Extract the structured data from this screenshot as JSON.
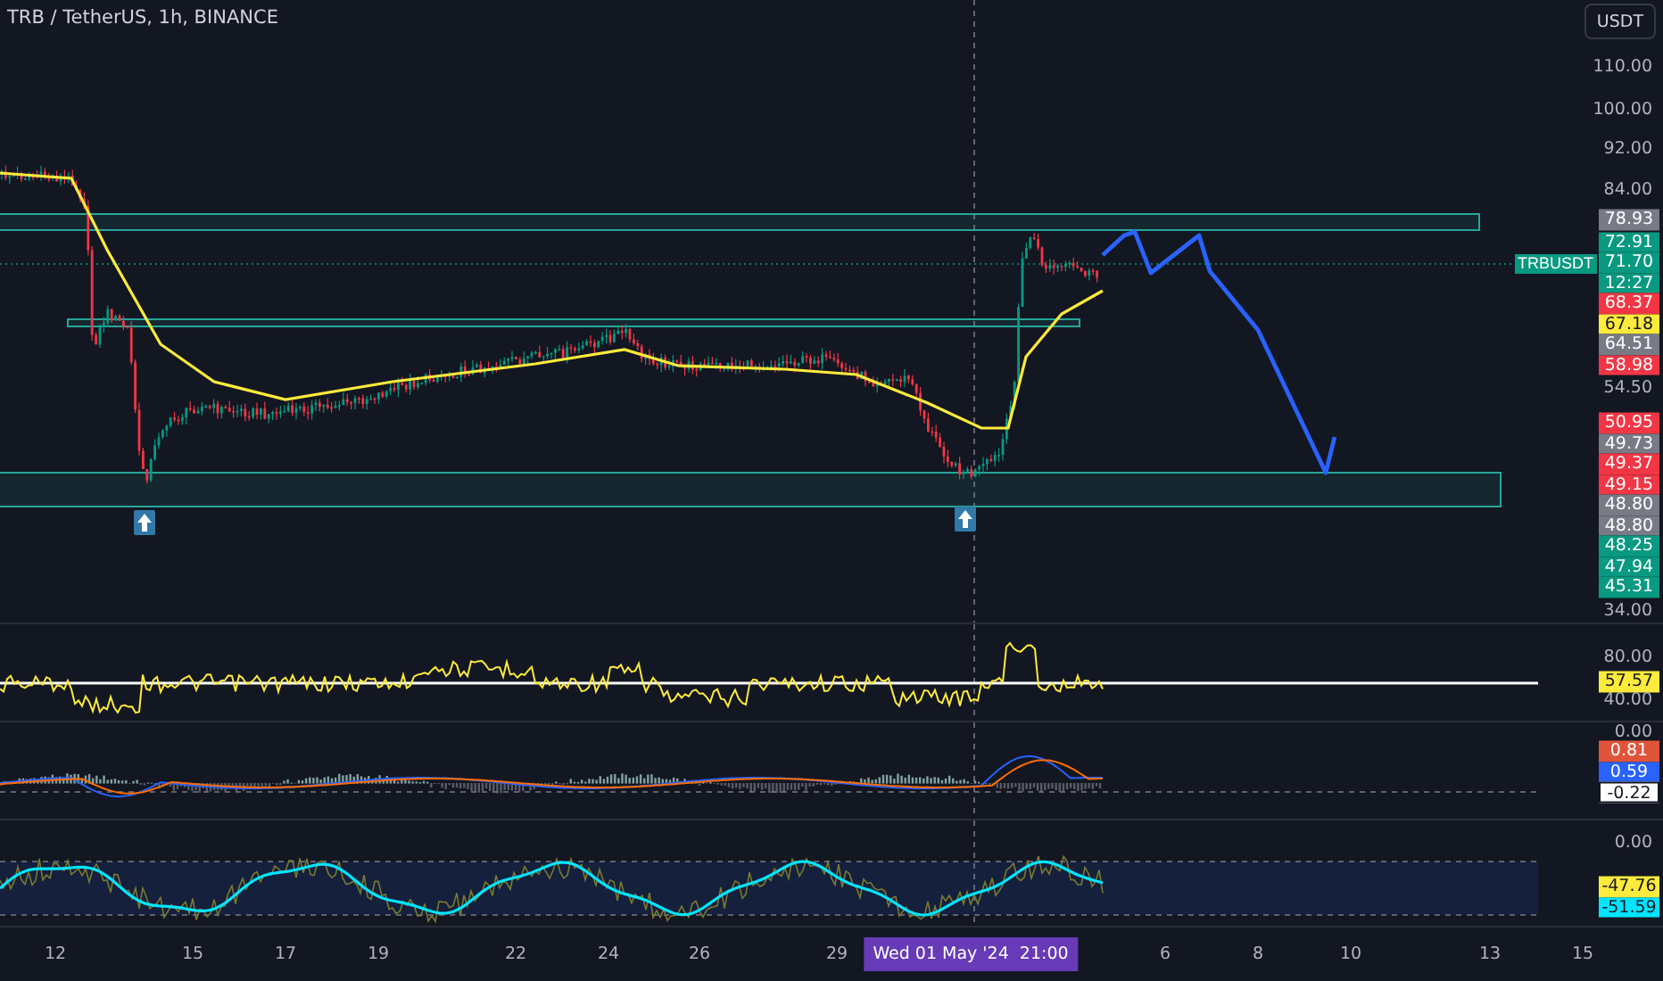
{
  "legend": {
    "symbol": "TRB / TetherUS, 1h, BINANCE"
  },
  "symbol_label": "TRBUSDT",
  "price_axis": {
    "unit_button": "USDT",
    "items": [
      {
        "kind": "tick",
        "text": "110.00"
      },
      {
        "kind": "tick",
        "text": "100.00"
      },
      {
        "kind": "tick",
        "text": "92.00"
      },
      {
        "kind": "tick",
        "text": "84.00"
      },
      {
        "kind": "tag",
        "text": "78.93",
        "color": "#787b86"
      },
      {
        "kind": "tag",
        "text": "72.91",
        "color": "#089981"
      },
      {
        "kind": "tag",
        "text": "71.70",
        "color": "#089981"
      },
      {
        "kind": "tag",
        "text": "12:27",
        "color": "#089981"
      },
      {
        "kind": "tag",
        "text": "68.37",
        "color": "#f23645"
      },
      {
        "kind": "tag",
        "text": "67.18",
        "color": "#ffeb3b"
      },
      {
        "kind": "tag",
        "text": "64.51",
        "color": "#787b86"
      },
      {
        "kind": "tag",
        "text": "58.98",
        "color": "#f23645"
      },
      {
        "kind": "tick",
        "text": "54.50"
      },
      {
        "kind": "tag",
        "text": "50.95",
        "color": "#f23645"
      },
      {
        "kind": "tag",
        "text": "49.73",
        "color": "#787b86"
      },
      {
        "kind": "tag",
        "text": "49.37",
        "color": "#f23645"
      },
      {
        "kind": "tag",
        "text": "49.15",
        "color": "#f23645"
      },
      {
        "kind": "tag",
        "text": "48.80",
        "color": "#787b86"
      },
      {
        "kind": "tag",
        "text": "48.80",
        "color": "#787b86"
      },
      {
        "kind": "tag",
        "text": "48.25",
        "color": "#089981"
      },
      {
        "kind": "tag",
        "text": "47.94",
        "color": "#089981"
      },
      {
        "kind": "tag",
        "text": "45.31",
        "color": "#089981"
      },
      {
        "kind": "tick",
        "text": "34.00"
      }
    ]
  },
  "rsi_pane": {
    "axis_items": [
      {
        "kind": "tick",
        "text": "80.00"
      },
      {
        "kind": "tag",
        "text": "57.57",
        "color": "#ffeb3b"
      },
      {
        "kind": "tick",
        "text": "40.00"
      }
    ]
  },
  "macd_pane": {
    "axis_items": [
      {
        "kind": "tick",
        "text": "0.00"
      },
      {
        "kind": "tag",
        "text": "0.81",
        "color": "#e0553a"
      },
      {
        "kind": "tag",
        "text": "0.59",
        "color": "#2962ff"
      },
      {
        "kind": "tag",
        "text": "-0.22",
        "color": "#ffffff"
      }
    ]
  },
  "stoch_pane": {
    "axis_items": [
      {
        "kind": "tick",
        "text": "0.00"
      },
      {
        "kind": "tag",
        "text": "-47.76",
        "color": "#ffeb3b"
      },
      {
        "kind": "tag",
        "text": "-51.59",
        "color": "#00e5ff"
      }
    ]
  },
  "time_axis": {
    "labels": [
      "12",
      "15",
      "17",
      "19",
      "22",
      "24",
      "26",
      "29",
      "6",
      "8",
      "10",
      "13",
      "15"
    ],
    "cursor_label": "Wed 01 May '24  21:00"
  }
}
